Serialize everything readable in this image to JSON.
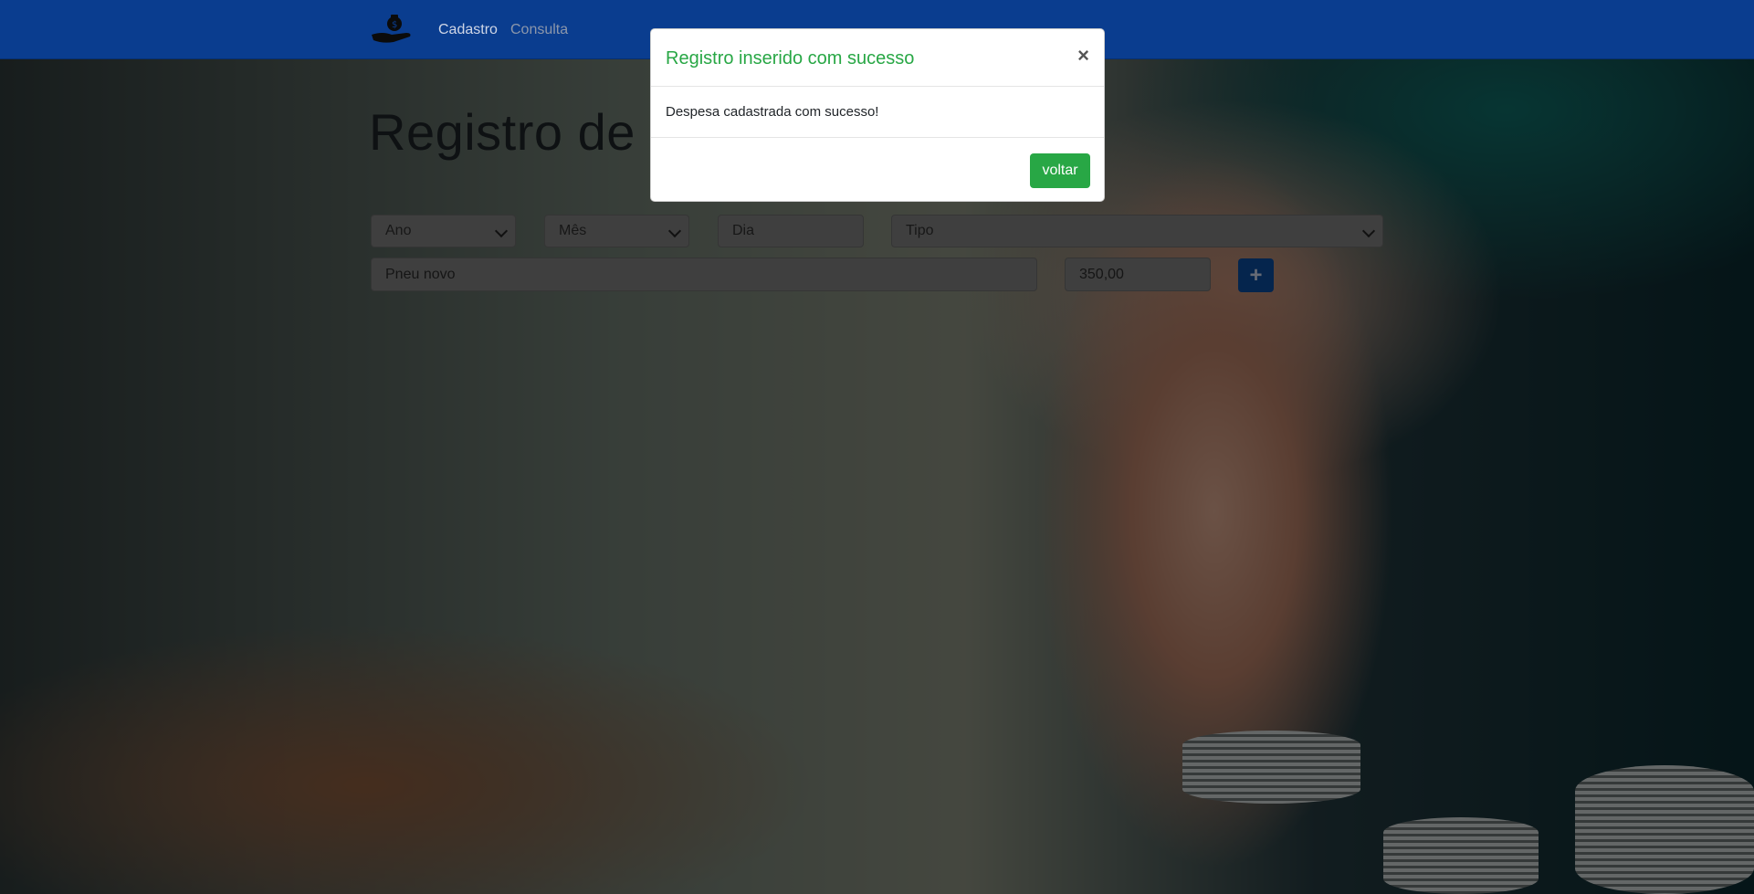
{
  "nav": {
    "brand_icon": "money-bag-hand-icon",
    "links": [
      {
        "label": "Cadastro"
      },
      {
        "label": "Consulta"
      }
    ]
  },
  "page": {
    "title": "Registro de n"
  },
  "form": {
    "ano": {
      "placeholder": "Ano"
    },
    "mes": {
      "placeholder": "Mês"
    },
    "dia": {
      "placeholder": "Dia"
    },
    "tipo": {
      "placeholder": "Tipo"
    },
    "descricao": {
      "value": "Pneu novo"
    },
    "valor": {
      "value": "350,00"
    },
    "add_label": "+"
  },
  "modal": {
    "title": "Registro inserido com sucesso",
    "close_label": "×",
    "message": "Despesa cadastrada com sucesso!",
    "button_label": "voltar",
    "accent": "#28a745"
  },
  "colors": {
    "navbar": "#0a3d8f",
    "primary_button": "#0a4a9a",
    "success": "#28a745"
  }
}
